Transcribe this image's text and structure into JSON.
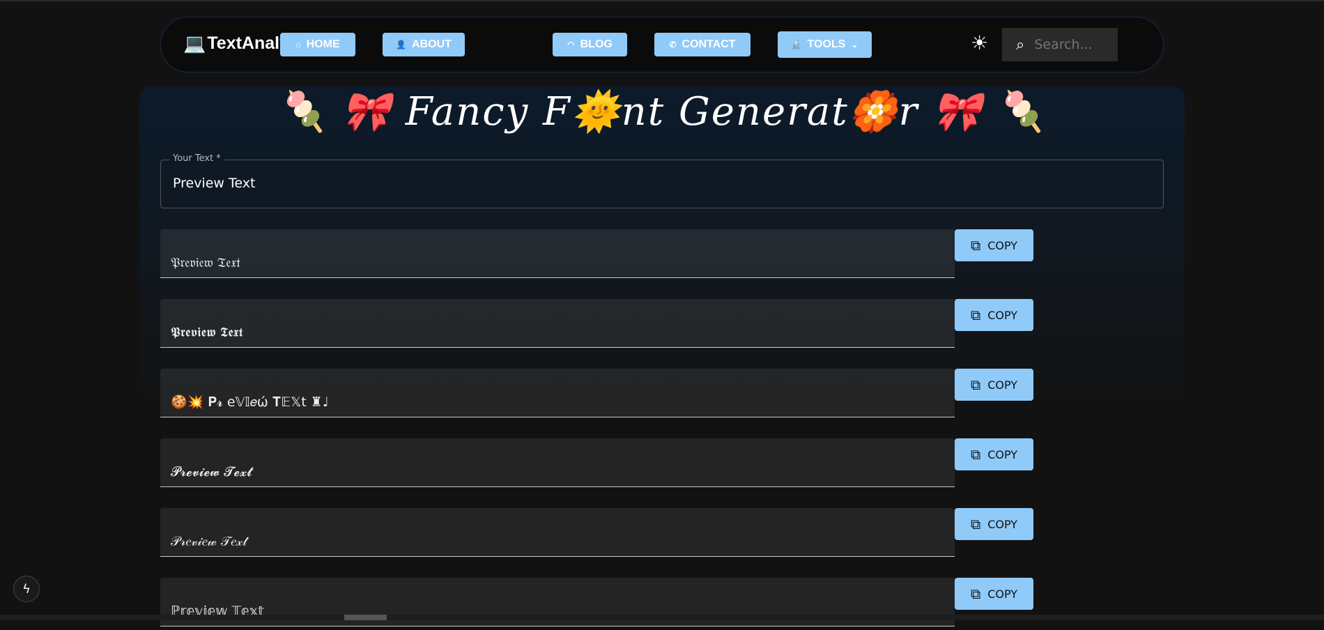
{
  "nav": {
    "brand": "TextAnalyser",
    "items": [
      {
        "label": "HOME",
        "icon": "home-icon"
      },
      {
        "label": "ABOUT",
        "icon": "person-icon"
      },
      {
        "label": "BLOG",
        "icon": "rss-icon"
      },
      {
        "label": "CONTACT",
        "icon": "phone-icon"
      },
      {
        "label": "TOOLS",
        "icon": "microscope-icon"
      }
    ],
    "search_placeholder": "Search..."
  },
  "page": {
    "title_left": "🍡 🎀 ",
    "title": "Fancy F🌞nt Generat🏵️r",
    "title_right": " 🎀 🍡"
  },
  "input": {
    "label": "Your Text *",
    "value": "Preview Text"
  },
  "copy_label": "COPY",
  "results": [
    "𝔓𝔯𝔢𝔳𝔦𝔢𝔴 𝔗𝔢𝔵𝔱",
    "𝕻𝖗𝖊𝖛𝖎𝖊𝖜 𝕿𝖊𝖝𝖙",
    "🍪💥  𝐏𝓻 e𝕍𝕀𝑒ώ 𝐓𝔼𝕏t  ♜♩",
    "𝓟𝓻𝓮𝓿𝓲𝓮𝔀 𝓣𝓮𝔁𝓽",
    "𝒫𝓇𝑒𝓋𝒾𝑒𝓌 𝒯𝑒𝓍𝓉",
    "ℙ𝕣𝕖𝕧𝕚𝕖𝕨 𝕋𝕖𝕩𝕥"
  ]
}
